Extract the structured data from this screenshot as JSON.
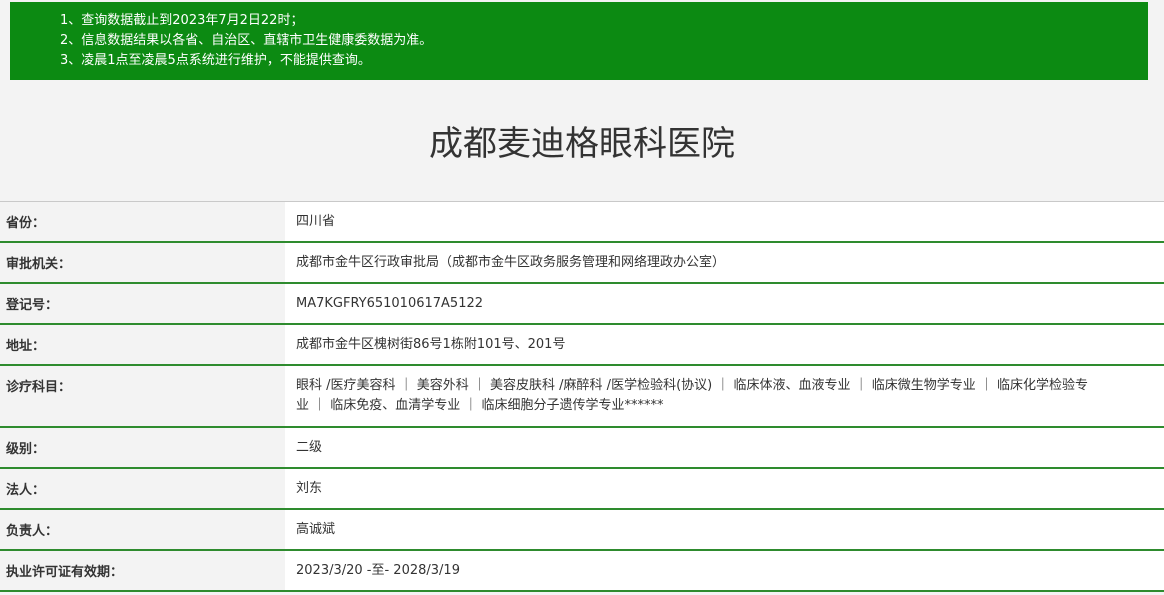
{
  "notice": {
    "lines": [
      "1、查询数据截止到2023年7月2日22时；",
      "2、信息数据结果以各省、自治区、直辖市卫生健康委数据为准。",
      "3、凌晨1点至凌晨5点系统进行维护，不能提供查询。"
    ]
  },
  "page": {
    "title": "成都麦迪格眼科医院"
  },
  "rows": [
    {
      "label": "省份：",
      "value": "四川省"
    },
    {
      "label": "审批机关：",
      "value": "成都市金牛区行政审批局（成都市金牛区政务服务管理和网络理政办公室）"
    },
    {
      "label": "登记号：",
      "value": "MA7KGFRY651010617A5122"
    },
    {
      "label": "地址：",
      "value": "成都市金牛区槐树街86号1栋附101号、201号"
    },
    {
      "label": "诊疗科目：",
      "value_line1": "眼科 /医疗美容科 ｜ 美容外科 ｜ 美容皮肤科 /麻醉科 /医学检验科(协议) ｜ 临床体液、血液专业 ｜ 临床微生物学专业 ｜ 临床化学检验专",
      "value_line2": "业 ｜ 临床免疫、血清学专业 ｜ 临床细胞分子遗传学专业******"
    },
    {
      "label": "级别：",
      "value": "二级"
    },
    {
      "label": "法人：",
      "value": "刘东"
    },
    {
      "label": "负责人：",
      "value": "高诚斌"
    },
    {
      "label": "执业许可证有效期：",
      "value": "2023/3/20 -至- 2028/3/19"
    }
  ]
}
